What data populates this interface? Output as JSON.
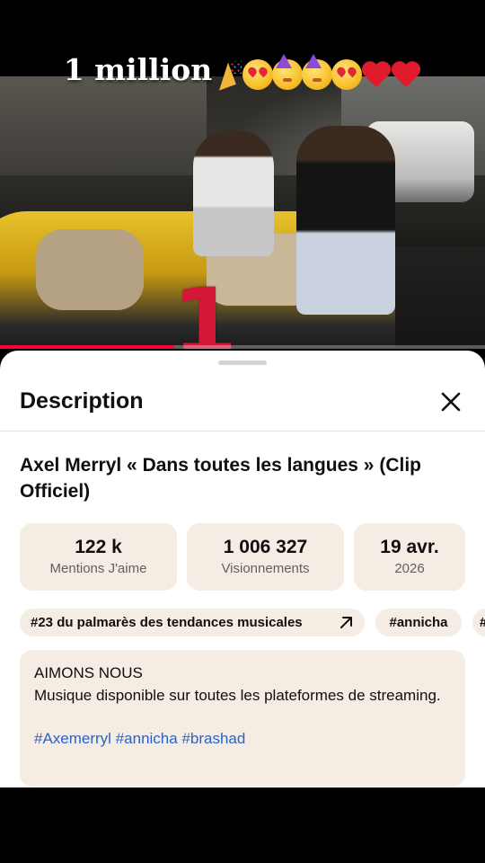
{
  "overlay": {
    "caption": "1 million",
    "emojis": [
      "party-popper-emoji",
      "heart-eyes-emoji",
      "partying-face-emoji",
      "partying-face-emoji",
      "heart-eyes-emoji",
      "red-heart-emoji",
      "red-heart-emoji"
    ]
  },
  "video": {
    "rank_number": "1",
    "progress_fraction": 0.36,
    "accent_color": "#ff0033"
  },
  "sheet": {
    "title": "Description",
    "video_title": "Axel Merryl « Dans toutes les langues » (Clip Officiel)",
    "stats": [
      {
        "value": "122 k",
        "label": "Mentions J'aime"
      },
      {
        "value": "1 006 327",
        "label": "Visionnements"
      },
      {
        "value": "19 avr.",
        "label": "2026"
      }
    ],
    "chips": {
      "trending": "#23 du palmarès des tendances musicales",
      "tag1": "#annicha",
      "tag2_partial": "#"
    },
    "description": {
      "line1": "AIMONS NOUS",
      "line2": "Musique disponible sur toutes les plateformes de streaming.",
      "hashtags": [
        "#Axemerryl",
        "#annicha",
        "#brashad"
      ]
    }
  },
  "colors": {
    "stat_bg": "#f5ece4",
    "link": "#2a63c7",
    "rank": "#d6173a"
  }
}
